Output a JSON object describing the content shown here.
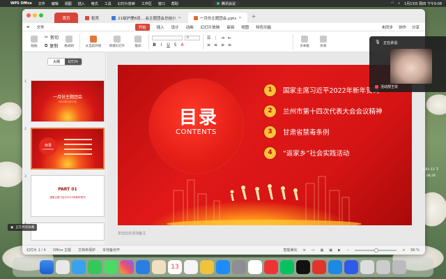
{
  "menubar": {
    "app": "WPS Office",
    "items": [
      "文件",
      "编辑",
      "视图",
      "插入",
      "格式",
      "工具",
      "幻灯片放映",
      "工作区",
      "窗口",
      "帮助"
    ],
    "clock": "1月13日 周四 下午9:08",
    "meeting_pill": "腾讯会议"
  },
  "tabs": {
    "home": "首页",
    "tab1": "稻壳",
    "tab2": "21级护理6班....会主题团会总结小",
    "tab3": "一月份主题团会.pptx"
  },
  "ribbon_tabs": {
    "start": "开始",
    "items": [
      "插入",
      "设计",
      "动画",
      "幻灯片放映",
      "审阅",
      "视图",
      "特色功能"
    ],
    "file": "文件",
    "right": [
      "未同步",
      "协作",
      "分享"
    ]
  },
  "ribbon": {
    "paste": "粘贴",
    "cut": "剪切",
    "copy": "复制",
    "format": "格式刷",
    "from_start": "从当前开始",
    "new_slide": "新建幻灯片",
    "layout": "版式",
    "font_name": "",
    "font_size": "0",
    "textbox": "文本框",
    "shape": "形状"
  },
  "left_panel": {
    "outline": "大纲",
    "slides": "幻灯片",
    "thumb1_title": "一月份主题团会",
    "thumb1_sub": "2022年1月12日",
    "thumb2_title": "目录",
    "thumb2_sub": "CONTENTS",
    "thumb3_title": "PART 01",
    "thumb3_sub": "国家主席习近平2022年新年贺词",
    "nums": [
      "1",
      "2",
      "3",
      "4"
    ]
  },
  "slide": {
    "title": "目录",
    "subtitle": "CONTENTS",
    "items": [
      {
        "num": "1",
        "text": "国家主席习近平2022年新年贺词"
      },
      {
        "num": "2",
        "text": "兰州市第十四次代表大会会议精神"
      },
      {
        "num": "3",
        "text": "甘肃省禁毒条例"
      },
      {
        "num": "4",
        "text": "“返家乡”社会实践活动"
      }
    ],
    "notes_placeholder": "单击此处添加备注"
  },
  "status": {
    "slide_count": "幻灯片 2 / 4",
    "theme": "Office 主题",
    "protect": "文档未保护",
    "backup": "本地备份开",
    "smart": "智能美化",
    "zoom": "96 %"
  },
  "meeting": {
    "speaking_label": "正在讲话:",
    "speaker": "活动部王欢",
    "time1": "2-01-13 下",
    "time2": "08.26"
  },
  "screen_share": "正在共享屏幕",
  "dock_calendar_date": "13",
  "colors": {
    "accent": "#d8463a",
    "slide_red": "#d61414",
    "number_badge": "#ffc23a"
  }
}
